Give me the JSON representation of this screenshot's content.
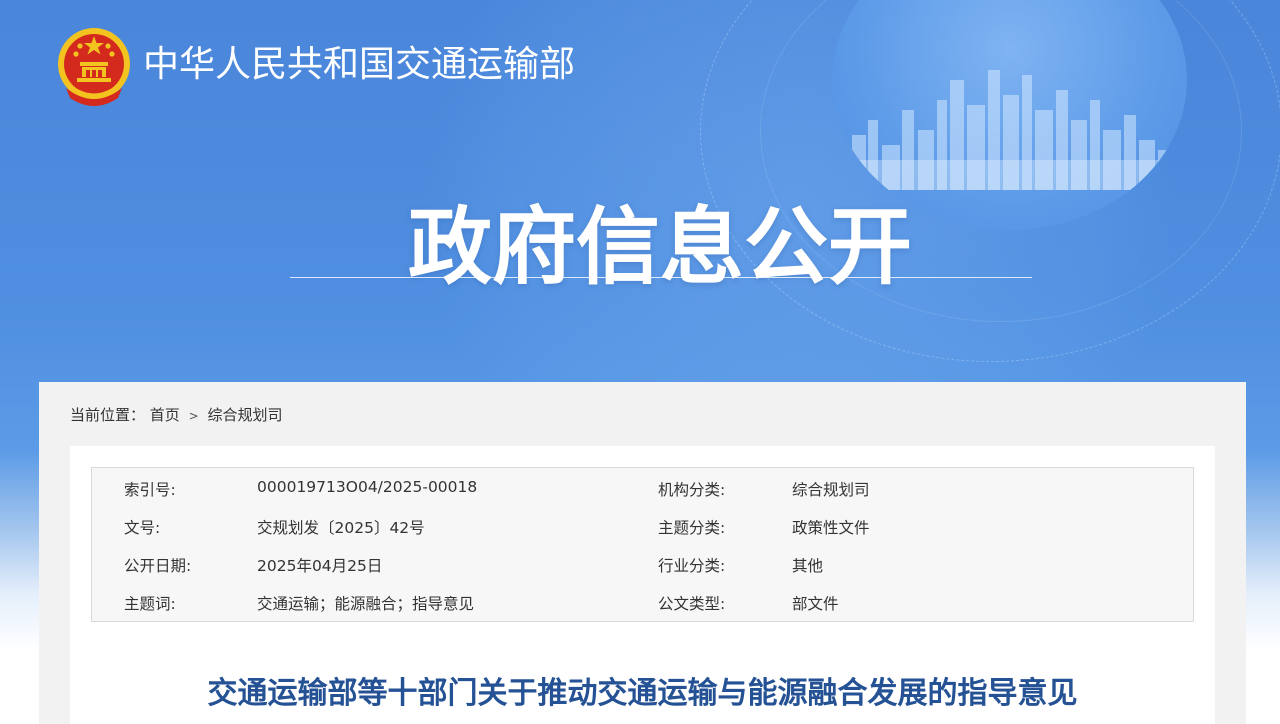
{
  "header": {
    "ministry_name": "中华人民共和国交通运输部",
    "page_title": "政府信息公开"
  },
  "breadcrumb": {
    "prefix": "当前位置：",
    "home": "首页",
    "separator": ">",
    "current": "综合规划司"
  },
  "meta": {
    "rows": [
      {
        "k1": "索引号:",
        "v1": "000019713O04/2025-00018",
        "k2": "机构分类:",
        "v2": "综合规划司"
      },
      {
        "k1": "文号:",
        "v1": "交规划发〔2025〕42号",
        "k2": "主题分类:",
        "v2": "政策性文件"
      },
      {
        "k1": "公开日期:",
        "v1": "2025年04月25日",
        "k2": "行业分类:",
        "v2": "其他"
      },
      {
        "k1": "主题词:",
        "v1": "交通运输；能源融合；指导意见",
        "k2": "公文类型:",
        "v2": "部文件"
      }
    ]
  },
  "document": {
    "title": "交通运输部等十部门关于推动交通运输与能源融合发展的指导意见"
  },
  "colors": {
    "banner_blue": "#4a86da",
    "title_blue": "#255294",
    "emblem_red": "#d42a1e",
    "emblem_gold": "#f3c320"
  },
  "icons": {
    "emblem": "national-emblem-icon"
  }
}
